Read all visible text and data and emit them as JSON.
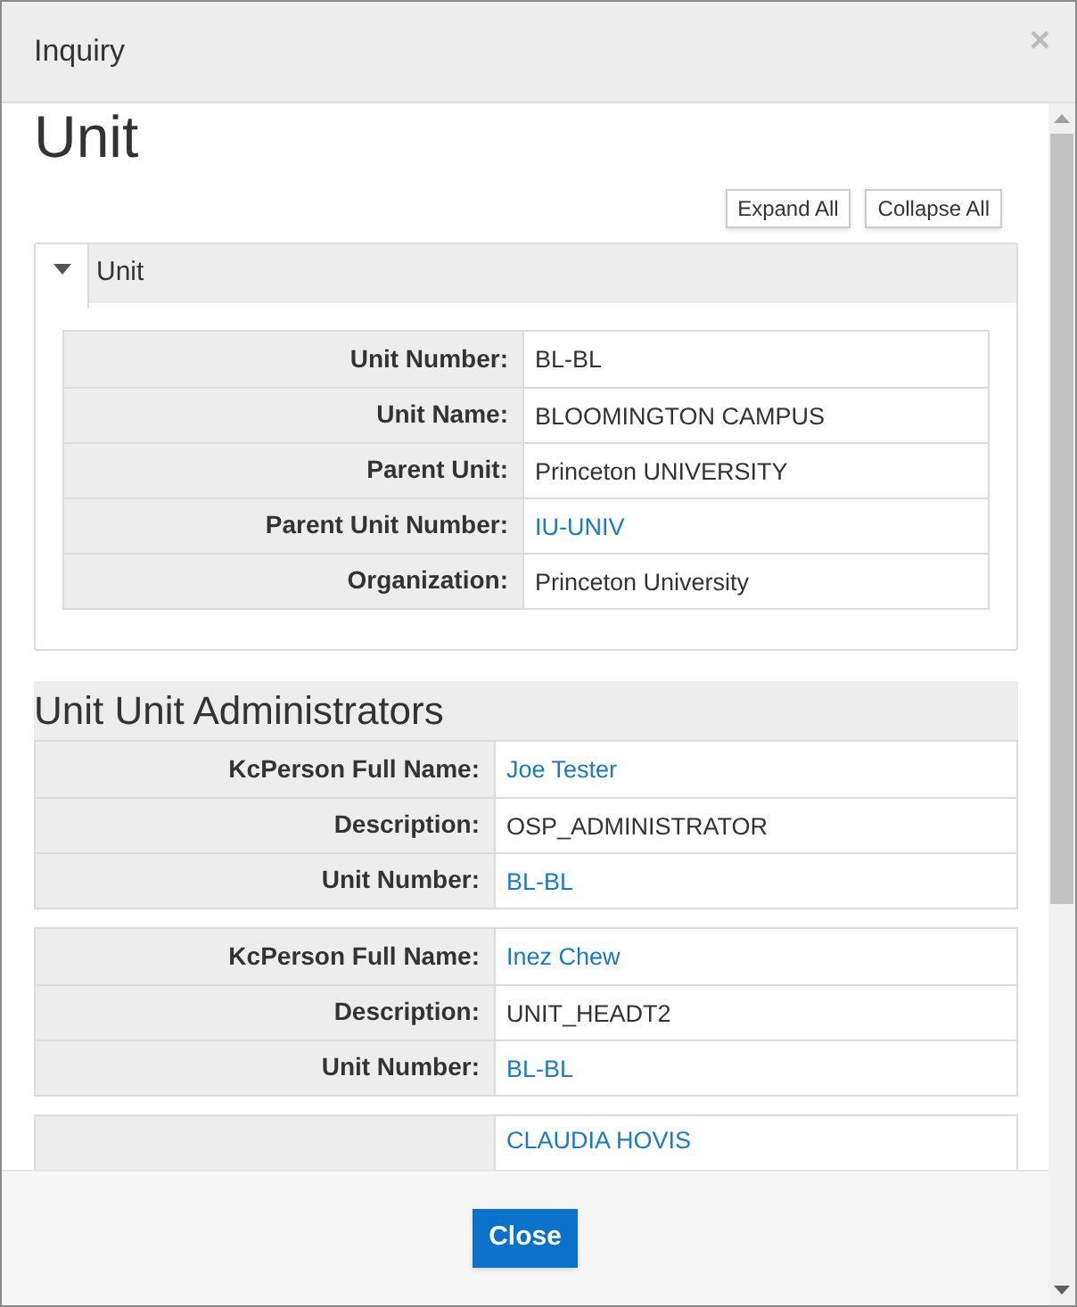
{
  "dialog": {
    "title": "Inquiry",
    "close_symbol": "×"
  },
  "page_title": "Unit",
  "toolbar_buttons": [
    "Expand All",
    "Collapse All"
  ],
  "unit_section": {
    "title": "Unit",
    "expanded": true,
    "fields": [
      {
        "label": "Unit Number:",
        "value": "BL-BL",
        "link": false
      },
      {
        "label": "Unit Name:",
        "value": "BLOOMINGTON CAMPUS",
        "link": false
      },
      {
        "label": "Parent Unit:",
        "value": "Princeton UNIVERSITY",
        "link": false
      },
      {
        "label": "Parent Unit Number:",
        "value": "IU-UNIV",
        "link": true
      },
      {
        "label": "Organization:",
        "value": "Princeton University",
        "link": false
      }
    ]
  },
  "admin_section": {
    "title": "Unit Unit Administrators",
    "records": [
      {
        "fields": [
          {
            "label": "KcPerson Full Name:",
            "value": "Joe Tester",
            "link": true
          },
          {
            "label": "Description:",
            "value": "OSP_ADMINISTRATOR",
            "link": false
          },
          {
            "label": "Unit Number:",
            "value": "BL-BL",
            "link": true
          }
        ]
      },
      {
        "fields": [
          {
            "label": "KcPerson Full Name:",
            "value": "Inez Chew",
            "link": true
          },
          {
            "label": "Description:",
            "value": "UNIT_HEADT2",
            "link": false
          },
          {
            "label": "Unit Number:",
            "value": "BL-BL",
            "link": true
          }
        ]
      },
      {
        "fields": [
          {
            "value": "CLAUDIA HOVIS",
            "link": true
          }
        ]
      }
    ]
  },
  "footer_button": "Close"
}
